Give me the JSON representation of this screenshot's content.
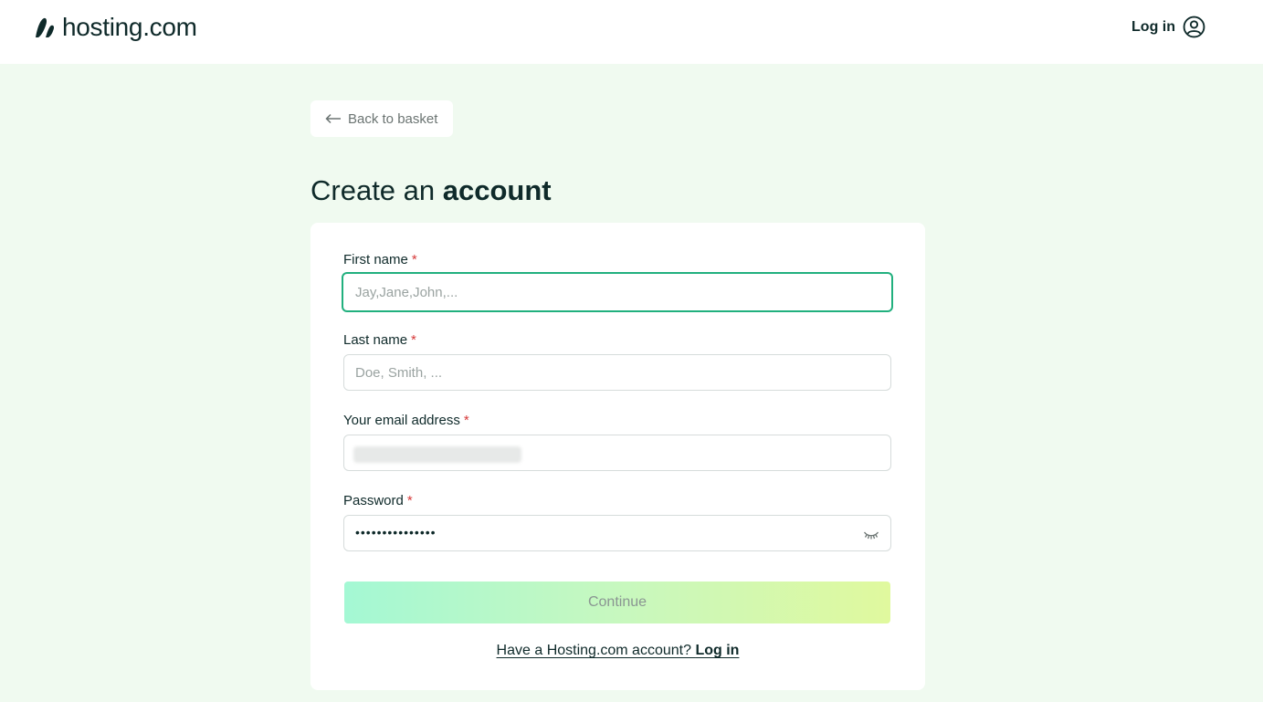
{
  "header": {
    "logo_text": "hosting.com",
    "login_label": "Log in"
  },
  "back": {
    "label": "Back to basket"
  },
  "title": {
    "prefix": "Create an",
    "bold": "account"
  },
  "form": {
    "required_mark": "*",
    "first_name": {
      "label": "First name",
      "placeholder": "Jay,Jane,John,..."
    },
    "last_name": {
      "label": "Last name",
      "placeholder": "Doe, Smith, ..."
    },
    "email": {
      "label": "Your email address"
    },
    "password": {
      "label": "Password",
      "masked_value": "•••••••••••••••"
    },
    "continue_label": "Continue",
    "footer": {
      "question": "Have a Hosting.com account?",
      "link": "Log in"
    }
  },
  "colors": {
    "background": "#f0faf0",
    "focus": "#21b07e",
    "required": "#d63a3a",
    "text": "#0f2a2a"
  },
  "icons": [
    "logo-mark-icon",
    "user-circle-icon",
    "arrow-left-icon",
    "eye-closed-icon"
  ]
}
